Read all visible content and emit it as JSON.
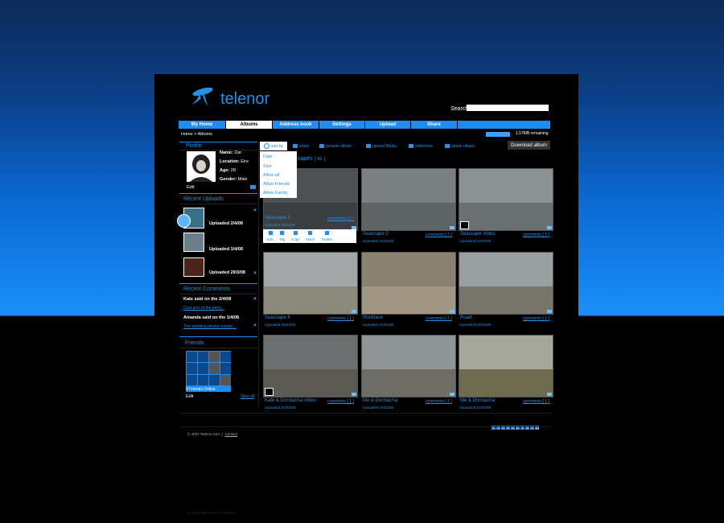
{
  "brand": {
    "name": "telenor",
    "colors": {
      "accent": "#1f8cf3",
      "bg": "#000000"
    }
  },
  "search": {
    "label": "Search",
    "value": ""
  },
  "nav": [
    {
      "label": "My Home",
      "active": false
    },
    {
      "label": "Albums",
      "active": true
    },
    {
      "label": "Address book",
      "active": false
    },
    {
      "label": "Settings",
      "active": false
    },
    {
      "label": "Upload",
      "active": false
    },
    {
      "label": "Share",
      "active": false
    }
  ],
  "breadcrumb": "Home > Albums",
  "storage": {
    "used_fraction": 1.0,
    "text": "1.57MB remaining"
  },
  "profile": {
    "heading": "Profile",
    "name_label": "Name:",
    "name": "Dar",
    "location_label": "Location:",
    "location": "Eire",
    "age_label": "Age:",
    "age": "28",
    "gender_label": "Gender:",
    "gender": "Male",
    "edit": "Edit"
  },
  "recent_uploads": {
    "heading": "Recent Uploads",
    "items": [
      {
        "label": "Uploaded 2/4/08"
      },
      {
        "label": "Uploaded 1/4/08"
      },
      {
        "label": "Uploaded 29/3/08"
      }
    ]
  },
  "recent_comments": {
    "heading": "Recent Comments",
    "items": [
      {
        "author": "Kate said on the 2/4/08",
        "link": "Cool pics of the party..."
      },
      {
        "author": "Amanda said on the 1/4/08",
        "link": "The wedding photos turned ..."
      }
    ]
  },
  "friends": {
    "heading": "Friends",
    "online": "9 Friends  Online",
    "edit": "Edit",
    "view_all": "View all"
  },
  "toolbar": {
    "sort_by": "sort by",
    "share": "share",
    "rename_album": "rename album",
    "upload_media": "upload Media",
    "slideshow": "slideshow",
    "delete_album": "delete album",
    "download_album": "Download album"
  },
  "sort_options": [
    "Date",
    "Size",
    "Allow all",
    "Allow Friends",
    "Allow Family"
  ],
  "album": {
    "title": "capes",
    "count": "[ 41 ]"
  },
  "photo_actions": [
    "Edit",
    "Tag",
    "Copy",
    "Move",
    "Delete"
  ],
  "photos": [
    {
      "title": "Seascape 1",
      "date": "Uploaded 02/04/08",
      "comments": "comments [ 1 ]",
      "video": false
    },
    {
      "title": "Seascape 2",
      "date": "Uploaded 02/04/08",
      "comments": "comments [ 1 ]",
      "video": false
    },
    {
      "title": "Seascape  Video",
      "date": "Uploaded 02/04/08",
      "comments": "comments [ 1 ]",
      "video": true
    },
    {
      "title": "Seascape 4",
      "date": "Uploaded 02/04/08",
      "comments": "comments [ 1 ]",
      "video": false
    },
    {
      "title": "Rockface",
      "date": "Uploaded 02/04/08",
      "comments": "comments [ 1 ]",
      "video": false
    },
    {
      "title": "Road",
      "date": "Uploaded 02/04/08",
      "comments": "comments [ 1 ]",
      "video": false
    },
    {
      "title": "Kate & Donnacha Video",
      "date": "Uploaded 02/04/08",
      "comments": "comments [ 1 ]",
      "video": true
    },
    {
      "title": "Me & Donnacha",
      "date": "Uploaded 02/04/08",
      "comments": "comments [ 1 ]",
      "video": false
    },
    {
      "title": "Me & Donnacha",
      "date": "Uploaded 02/04/08",
      "comments": "comments [ 1 ]",
      "video": false
    }
  ],
  "pager": [
    "1",
    "2",
    "3",
    "4",
    "5",
    "6",
    "7",
    "8",
    "9",
    "10"
  ],
  "footer": {
    "copyright": "© 2007 Telenor ASA",
    "contact": "Contact"
  }
}
